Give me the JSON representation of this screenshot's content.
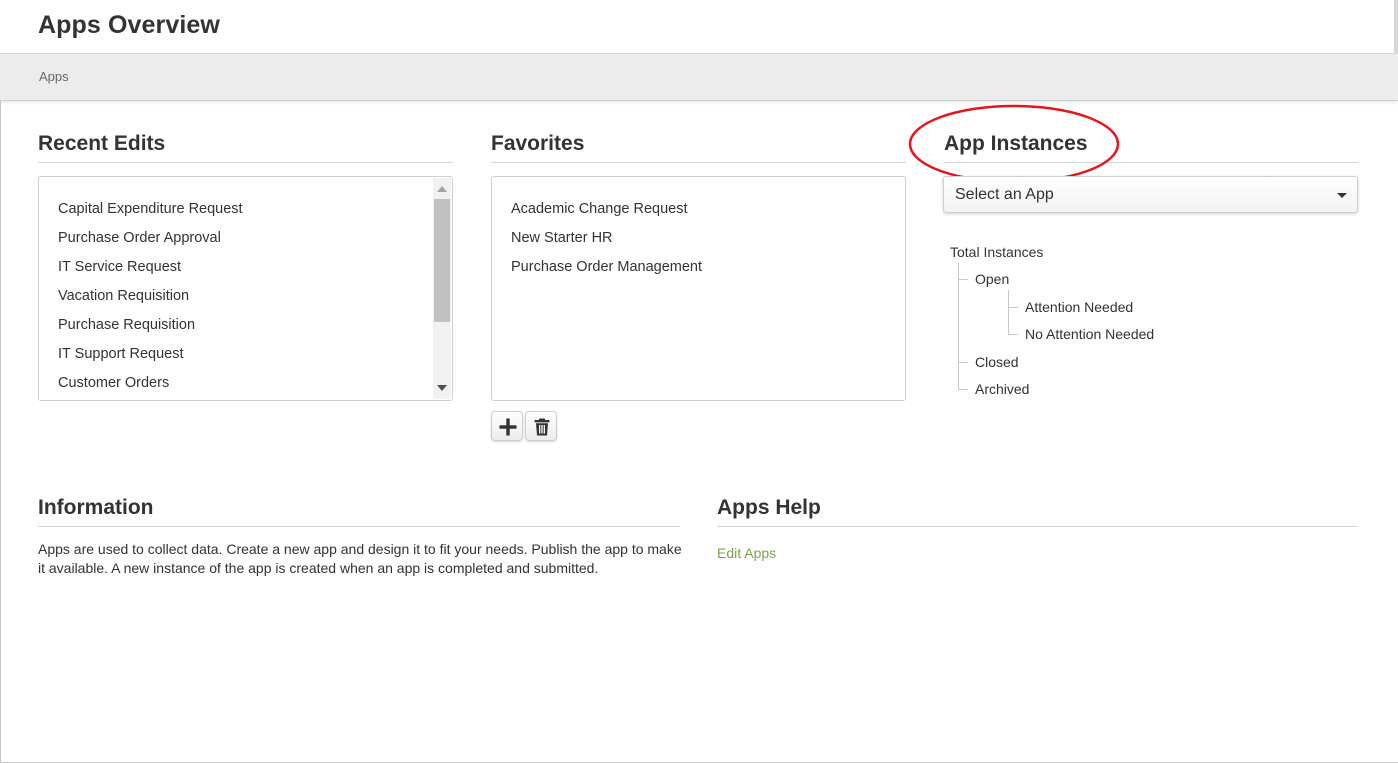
{
  "header": {
    "title": "Apps Overview"
  },
  "breadcrumb": {
    "items": [
      "Apps"
    ]
  },
  "recent_edits": {
    "title": "Recent Edits",
    "items": [
      "Capital Expenditure Request",
      "Purchase Order Approval",
      "IT Service Request",
      "Vacation Requisition",
      "Purchase Requisition",
      "IT Support Request",
      "Customer Orders"
    ]
  },
  "favorites": {
    "title": "Favorites",
    "items": [
      "Academic Change Request",
      "New Starter HR",
      "Purchase Order Management"
    ],
    "add_icon": "plus-icon",
    "delete_icon": "trash-icon"
  },
  "app_instances": {
    "title": "App Instances",
    "select_label": "Select an App",
    "tree": {
      "total": "Total Instances",
      "open": "Open",
      "attention_needed": "Attention Needed",
      "no_attention_needed": "No Attention Needed",
      "closed": "Closed",
      "archived": "Archived"
    }
  },
  "information": {
    "title": "Information",
    "text": "Apps are used to collect data. Create a new app and design it to fit your needs. Publish the app to make it available. A new instance of the app is created when an app is completed and submitted."
  },
  "apps_help": {
    "title": "Apps Help",
    "link": "Edit Apps"
  },
  "colors": {
    "link": "#7aa64b",
    "highlight": "#e8141b",
    "header_bg": "#ffffff",
    "breadcrumb_bg": "#ececec"
  }
}
